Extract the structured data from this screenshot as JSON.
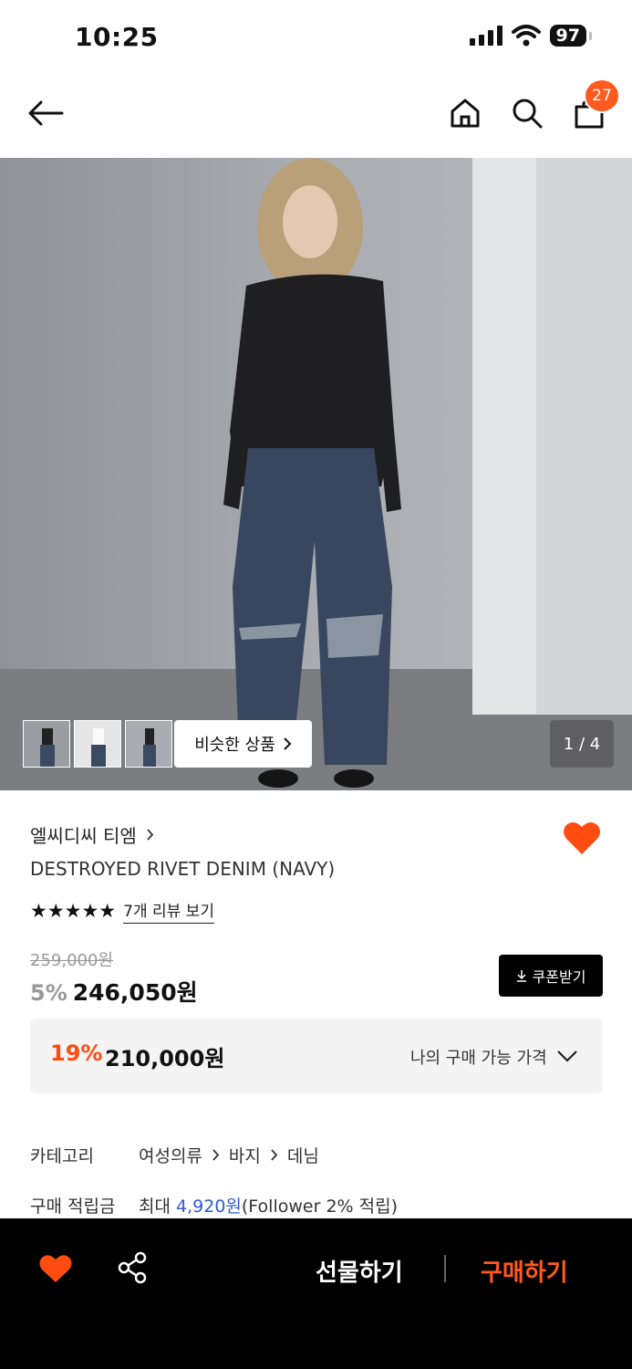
{
  "status_bar": {
    "time": "10:25",
    "battery": "97"
  },
  "nav": {
    "cart_count": "27"
  },
  "gallery": {
    "similar_label": "비슷한 상품",
    "page_indicator": "1 / 4"
  },
  "product": {
    "brand": "엘씨디씨 티엠",
    "name": "DESTROYED RIVET DENIM (NAVY)",
    "rating_stars": "★★★★★",
    "review_link": "7개 리뷰 보기",
    "original_price": "259,000원",
    "sale_percent": "5%",
    "sale_price": "246,050원",
    "coupon_label": "쿠폰받기"
  },
  "my_price": {
    "percent": "19%",
    "price": "210,000원",
    "label": "나의 구매 가능 가격"
  },
  "info": {
    "category_key": "카테고리",
    "category_path": [
      "여성의류",
      "바지",
      "데님"
    ],
    "points_key": "구매 적립금",
    "points_prefix": "최대",
    "points_amount": "4,920원",
    "points_suffix": "(Follower 2% 적립)"
  },
  "bottom_bar": {
    "gift_label": "선물하기",
    "buy_label": "구매하기"
  },
  "colors": {
    "accent": "#ff5a1f",
    "link_blue": "#2d5bd6",
    "dark": "#000000"
  }
}
